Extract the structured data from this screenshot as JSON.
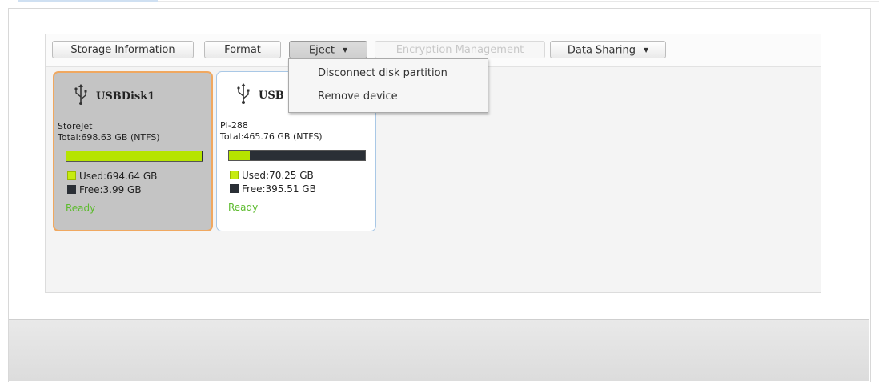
{
  "toolbar": {
    "storage_information": "Storage Information",
    "format": "Format",
    "eject": "Eject",
    "encryption_management": "Encryption Management",
    "data_sharing": "Data Sharing"
  },
  "eject_menu": {
    "items": [
      "Disconnect disk partition",
      "Remove device"
    ]
  },
  "disks": [
    {
      "name": "USBDisk1",
      "model": "StoreJet",
      "total": "Total:698.63 GB (NTFS)",
      "used": "Used:694.64 GB",
      "free": "Free:3.99 GB",
      "status": "Ready",
      "used_fraction": 0.994,
      "selected": true
    },
    {
      "name": "USBDisk2",
      "name_visible": "USB",
      "model": "PI-288",
      "total": "Total:465.76 GB (NTFS)",
      "used": "Used:70.25 GB",
      "free": "Free:395.51 GB",
      "status": "Ready",
      "used_fraction": 0.151,
      "selected": false
    }
  ],
  "colors": {
    "used": "#b6e400",
    "free": "#2a2f36",
    "selected_border": "#f0a860",
    "ready": "#5dbb2e"
  },
  "icons": [
    "usb-icon",
    "chevron-down-icon"
  ]
}
